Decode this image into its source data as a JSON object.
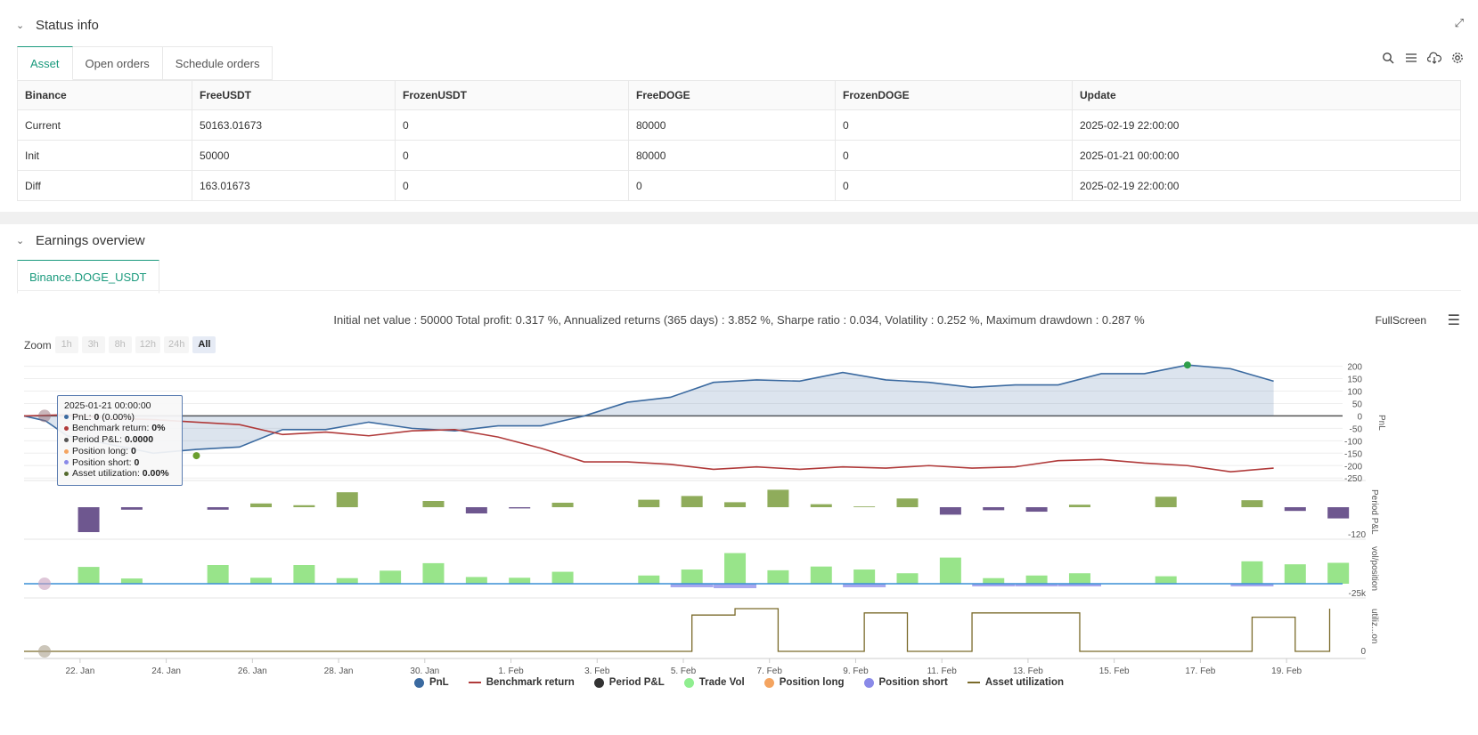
{
  "status": {
    "title": "Status info",
    "tabs": [
      "Asset",
      "Open orders",
      "Schedule orders"
    ],
    "table": {
      "headers": [
        "Binance",
        "FreeUSDT",
        "FrozenUSDT",
        "FreeDOGE",
        "FrozenDOGE",
        "Update"
      ],
      "rows": [
        {
          "label": "Current",
          "cells": [
            "50163.01673",
            "0",
            "80000",
            "0",
            "2025-02-19 22:00:00"
          ]
        },
        {
          "label": "Init",
          "cells": [
            "50000",
            "0",
            "80000",
            "0",
            "2025-01-21 00:00:00"
          ]
        },
        {
          "label": "Diff",
          "cells": [
            "163.01673",
            "0",
            "0",
            "0",
            "2025-02-19 22:00:00"
          ]
        }
      ]
    },
    "icons": [
      "search-icon",
      "list-icon",
      "cloud-download-icon",
      "gear-icon"
    ]
  },
  "earnings": {
    "title": "Earnings overview",
    "tab": "Binance.DOGE_USDT",
    "summary": "Initial net value : 50000 Total profit: 0.317 %, Annualized returns (365 days) : 3.852 %, Sharpe ratio : 0.034, Volatility : 0.252 %, Maximum drawdown : 0.287 %",
    "fullscreen": "FullScreen",
    "zoom": {
      "label": "Zoom",
      "options": [
        "1h",
        "3h",
        "8h",
        "12h",
        "24h",
        "All"
      ],
      "selected": "All"
    },
    "tooltip": {
      "date": "2025-01-21 00:00:00",
      "items": [
        {
          "label": "PnL:",
          "value": "0",
          "suffix": " (0.00%)",
          "color": "#3b6aa0"
        },
        {
          "label": "Benchmark return:",
          "value": "0%",
          "suffix": "",
          "color": "#b03a3a"
        },
        {
          "label": "Period P&L:",
          "value": "0.0000",
          "suffix": "",
          "color": "#555555"
        },
        {
          "label": "Position long:",
          "value": "0",
          "suffix": "",
          "color": "#f4a460"
        },
        {
          "label": "Position short:",
          "value": "0",
          "suffix": "",
          "color": "#8a8ae8"
        },
        {
          "label": "Asset utilization:",
          "value": "0.00%",
          "suffix": "",
          "color": "#556b2f"
        }
      ]
    },
    "legend": [
      {
        "label": "PnL",
        "type": "dot",
        "color": "#3b6aa0"
      },
      {
        "label": "Benchmark return",
        "type": "line",
        "color": "#b03a3a"
      },
      {
        "label": "Period P&L",
        "type": "dot",
        "color": "#333333"
      },
      {
        "label": "Trade Vol",
        "type": "dot",
        "color": "#90ee90"
      },
      {
        "label": "Position long",
        "type": "dot",
        "color": "#f4a460"
      },
      {
        "label": "Position short",
        "type": "dot",
        "color": "#8a8ae8"
      },
      {
        "label": "Asset utilization",
        "type": "line",
        "color": "#7a6a2a"
      }
    ]
  },
  "chart_data": {
    "type": "line",
    "x_ticks": [
      "22. Jan",
      "24. Jan",
      "26. Jan",
      "28. Jan",
      "30. Jan",
      "1. Feb",
      "3. Feb",
      "5. Feb",
      "7. Feb",
      "9. Feb",
      "11. Feb",
      "13. Feb",
      "15. Feb",
      "17. Feb",
      "19. Feb"
    ],
    "panes": [
      {
        "name": "PnL",
        "y_ticks": [
          200,
          150,
          100,
          50,
          0,
          -50,
          -100,
          -150,
          -200,
          -250
        ],
        "ylim": [
          -260,
          220
        ],
        "series": [
          {
            "name": "PnL",
            "color": "#3b6aa0",
            "points": [
              [
                0.0,
                0
              ],
              [
                0.5,
                -20
              ],
              [
                1.0,
                -80
              ],
              [
                2.0,
                -115
              ],
              [
                3.0,
                -150
              ],
              [
                4.0,
                -135
              ],
              [
                5.0,
                -125
              ],
              [
                6.0,
                -55
              ],
              [
                7.0,
                -55
              ],
              [
                8.0,
                -25
              ],
              [
                9.0,
                -50
              ],
              [
                10.0,
                -60
              ],
              [
                11.0,
                -40
              ],
              [
                12.0,
                -40
              ],
              [
                13.0,
                0
              ],
              [
                14.0,
                55
              ],
              [
                15.0,
                75
              ],
              [
                16.0,
                135
              ],
              [
                17.0,
                145
              ],
              [
                18.0,
                140
              ],
              [
                19.0,
                175
              ],
              [
                20.0,
                145
              ],
              [
                21.0,
                135
              ],
              [
                22.0,
                115
              ],
              [
                23.0,
                125
              ],
              [
                24.0,
                125
              ],
              [
                25.0,
                170
              ],
              [
                26.0,
                170
              ],
              [
                27.0,
                205
              ],
              [
                28.0,
                190
              ],
              [
                29.0,
                140
              ]
            ]
          },
          {
            "name": "Benchmark return",
            "color": "#b03a3a",
            "points": [
              [
                0.0,
                0
              ],
              [
                1.0,
                5
              ],
              [
                2.0,
                -10
              ],
              [
                3.0,
                -15
              ],
              [
                4.0,
                -25
              ],
              [
                5.0,
                -35
              ],
              [
                6.0,
                -75
              ],
              [
                7.0,
                -65
              ],
              [
                8.0,
                -80
              ],
              [
                9.0,
                -60
              ],
              [
                10.0,
                -55
              ],
              [
                11.0,
                -85
              ],
              [
                12.0,
                -130
              ],
              [
                13.0,
                -185
              ],
              [
                14.0,
                -185
              ],
              [
                15.0,
                -195
              ],
              [
                16.0,
                -215
              ],
              [
                17.0,
                -205
              ],
              [
                18.0,
                -215
              ],
              [
                19.0,
                -205
              ],
              [
                20.0,
                -210
              ],
              [
                21.0,
                -200
              ],
              [
                22.0,
                -210
              ],
              [
                23.0,
                -205
              ],
              [
                24.0,
                -180
              ],
              [
                25.0,
                -175
              ],
              [
                26.0,
                -190
              ],
              [
                27.0,
                -200
              ],
              [
                28.0,
                -225
              ],
              [
                29.0,
                -210
              ]
            ]
          }
        ]
      },
      {
        "name": "Period P&L",
        "y_ticks": [
          -120
        ],
        "series": [
          {
            "name": "Period P&L",
            "values": [
              {
                "t": 1.5,
                "v": -100
              },
              {
                "t": 2.5,
                "v": -10
              },
              {
                "t": 4.5,
                "v": -10
              },
              {
                "t": 5.5,
                "v": 15
              },
              {
                "t": 6.5,
                "v": 8
              },
              {
                "t": 7.5,
                "v": 60
              },
              {
                "t": 9.5,
                "v": 25
              },
              {
                "t": 10.5,
                "v": -25
              },
              {
                "t": 11.5,
                "v": -5
              },
              {
                "t": 12.5,
                "v": 18
              },
              {
                "t": 14.5,
                "v": 30
              },
              {
                "t": 15.5,
                "v": 45
              },
              {
                "t": 16.5,
                "v": 20
              },
              {
                "t": 17.5,
                "v": 70
              },
              {
                "t": 18.5,
                "v": 12
              },
              {
                "t": 19.5,
                "v": 3
              },
              {
                "t": 20.5,
                "v": 35
              },
              {
                "t": 21.5,
                "v": -30
              },
              {
                "t": 22.5,
                "v": -12
              },
              {
                "t": 23.5,
                "v": -18
              },
              {
                "t": 24.5,
                "v": 10
              },
              {
                "t": 26.5,
                "v": 42
              },
              {
                "t": 28.5,
                "v": 28
              },
              {
                "t": 29.5,
                "v": -15
              },
              {
                "t": 30.5,
                "v": -45
              }
            ]
          }
        ]
      },
      {
        "name": "vol/position",
        "y_ticks": [
          "-25k"
        ],
        "series": [
          {
            "name": "Trade Vol",
            "values": [
              {
                "t": 1.5,
                "v": 45
              },
              {
                "t": 2.5,
                "v": 14
              },
              {
                "t": 4.5,
                "v": 50
              },
              {
                "t": 5.5,
                "v": 16
              },
              {
                "t": 6.5,
                "v": 50
              },
              {
                "t": 7.5,
                "v": 15
              },
              {
                "t": 8.5,
                "v": 35
              },
              {
                "t": 9.5,
                "v": 55
              },
              {
                "t": 10.5,
                "v": 18
              },
              {
                "t": 11.5,
                "v": 16
              },
              {
                "t": 12.5,
                "v": 32
              },
              {
                "t": 14.5,
                "v": 22
              },
              {
                "t": 15.5,
                "v": 38
              },
              {
                "t": 16.5,
                "v": 82
              },
              {
                "t": 17.5,
                "v": 36
              },
              {
                "t": 18.5,
                "v": 46
              },
              {
                "t": 19.5,
                "v": 38
              },
              {
                "t": 20.5,
                "v": 28
              },
              {
                "t": 21.5,
                "v": 70
              },
              {
                "t": 22.5,
                "v": 15
              },
              {
                "t": 23.5,
                "v": 22
              },
              {
                "t": 24.5,
                "v": 28
              },
              {
                "t": 26.5,
                "v": 20
              },
              {
                "t": 28.5,
                "v": 60
              },
              {
                "t": 29.5,
                "v": 52
              },
              {
                "t": 30.5,
                "v": 56
              }
            ]
          },
          {
            "name": "Position short",
            "values": [
              {
                "t": 15.5,
                "v": -8
              },
              {
                "t": 16.5,
                "v": -10
              },
              {
                "t": 19.5,
                "v": -8
              },
              {
                "t": 22.5,
                "v": -6
              },
              {
                "t": 23.5,
                "v": -6
              },
              {
                "t": 24.5,
                "v": -6
              },
              {
                "t": 28.5,
                "v": -6
              }
            ]
          }
        ]
      },
      {
        "name": "utilization",
        "y_ticks": [
          0
        ],
        "series": [
          {
            "name": "Asset utilization",
            "color": "#7a6a2a",
            "steps": [
              [
                0,
                0
              ],
              [
                15.5,
                0
              ],
              [
                15.5,
                85
              ],
              [
                16.5,
                85
              ],
              [
                16.5,
                100
              ],
              [
                17.5,
                100
              ],
              [
                17.5,
                0
              ],
              [
                19.5,
                0
              ],
              [
                19.5,
                90
              ],
              [
                20.5,
                90
              ],
              [
                20.5,
                0
              ],
              [
                22.0,
                0
              ],
              [
                22.0,
                90
              ],
              [
                24.5,
                90
              ],
              [
                24.5,
                0
              ],
              [
                28.5,
                0
              ],
              [
                28.5,
                80
              ],
              [
                29.5,
                80
              ],
              [
                29.5,
                0
              ],
              [
                30.3,
                0
              ],
              [
                30.3,
                100
              ]
            ]
          }
        ]
      }
    ],
    "axis_labels": [
      "PnL",
      "Period P&L",
      "vol/position",
      "utiliz...on"
    ]
  }
}
